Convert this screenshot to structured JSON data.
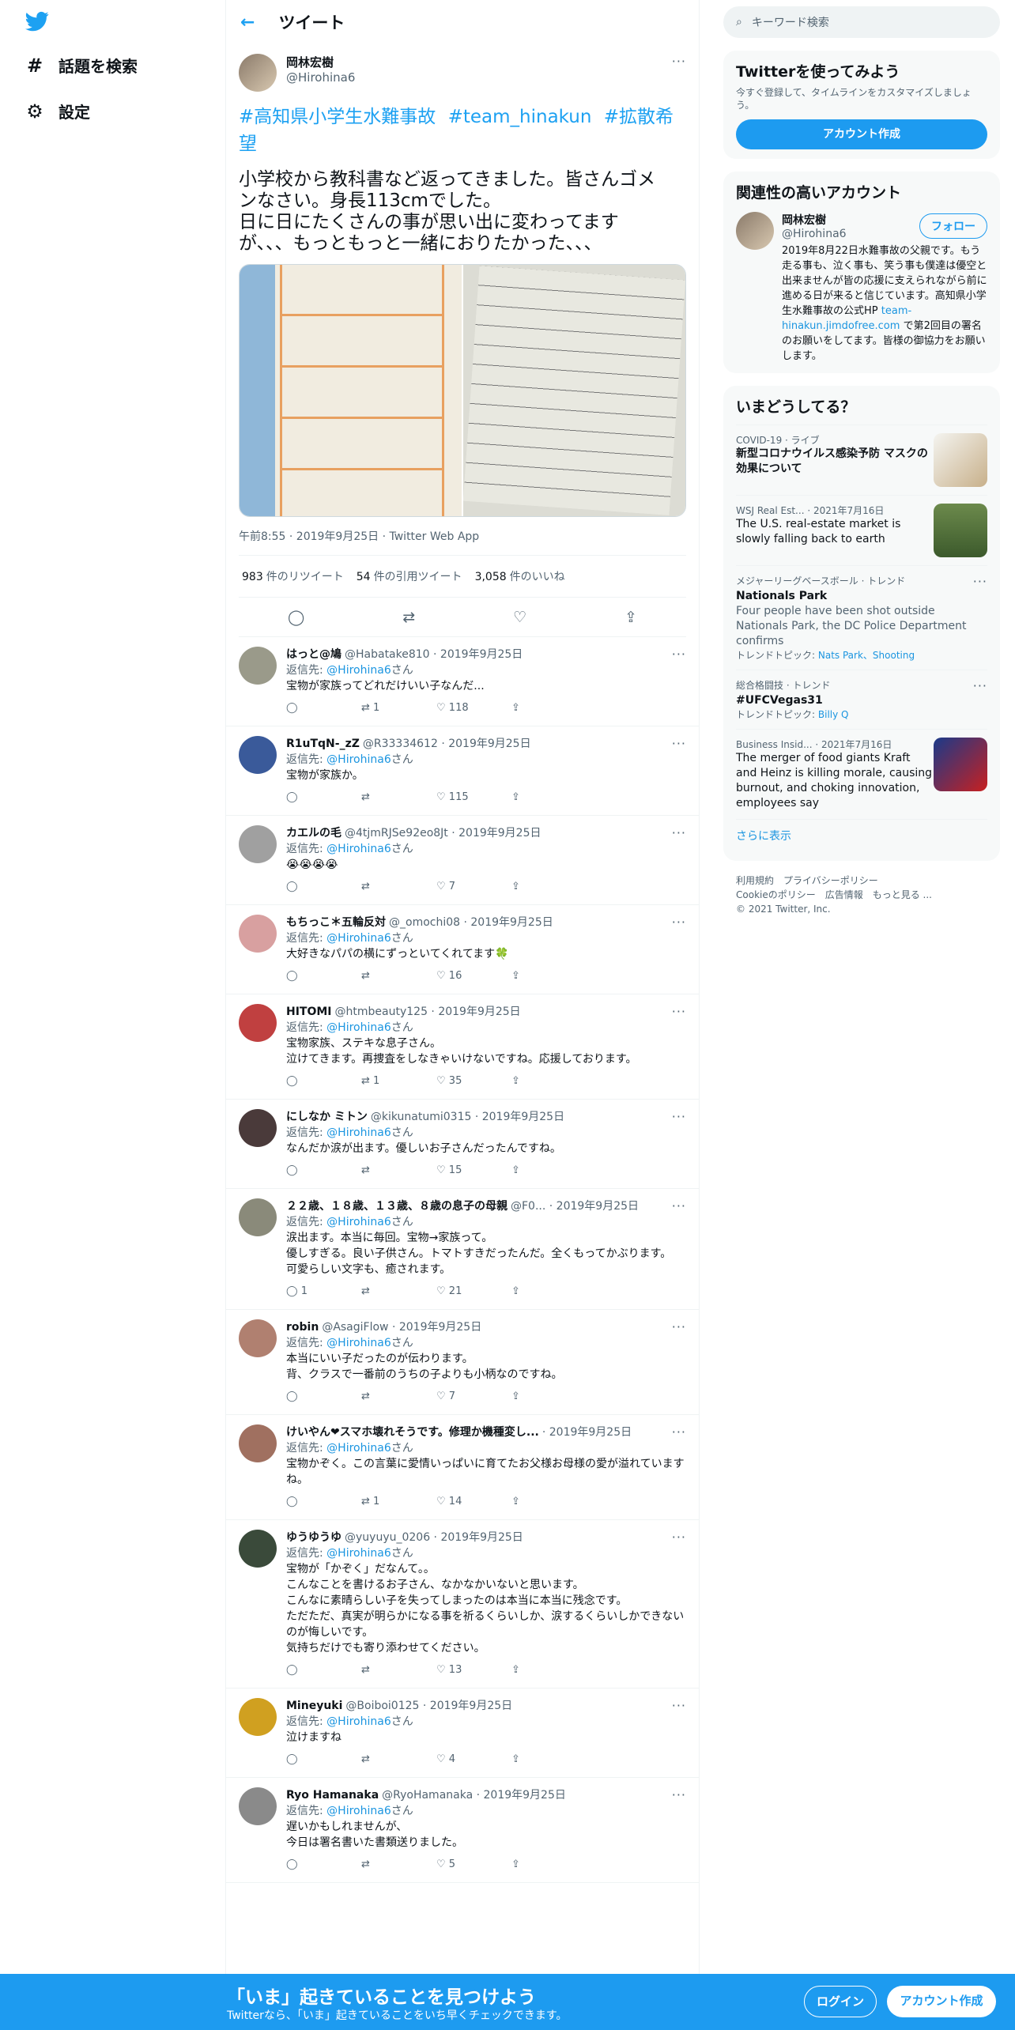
{
  "header": {
    "title": "ツイート"
  },
  "nav": {
    "explore": "話題を検索",
    "settings": "設定"
  },
  "tweet": {
    "name": "岡林宏樹",
    "handle": "@Hirohina6",
    "hashtags": "#高知県小学生水難事故 #team_hinakun #拡散希望",
    "body_line1": "小学校から教科書など返ってきました。皆さんゴメ",
    "body_line2": "ンなさい。身長113cmでした。",
    "body_line3": "日に日にたくさんの事が思い出に変わってます",
    "body_line4": "が、、、もっともっと一緒におりたかった、、、",
    "meta": "午前8:55 · 2019年9月25日 · Twitter Web App",
    "retweets_n": "983",
    "retweets_l": "件のリツイート",
    "quotes_n": "54",
    "quotes_l": "件の引用ツイート",
    "likes_n": "3,058",
    "likes_l": "件のいいね"
  },
  "reply_to_label": "返信先:",
  "reply_to_handle": "@Hirohina6",
  "reply_to_suffix": "さん",
  "replies": [
    {
      "name": "はっと@鳩",
      "handle": "@Habatake810 · 2019年9月25日",
      "text": "宝物が家族ってどれだけいい子なんだ...",
      "rt": "1",
      "like": "118"
    },
    {
      "name": "R1uTqN-_zZ",
      "handle": "@R33334612 · 2019年9月25日",
      "text": "宝物が家族か。",
      "rt": "",
      "like": "115"
    },
    {
      "name": "カエルの毛",
      "handle": "@4tjmRJSe92eo8Jt · 2019年9月25日",
      "text": "😭😭😭😭",
      "rt": "",
      "like": "7"
    },
    {
      "name": "もちっこ＊五輪反対",
      "handle": "@_omochi08 · 2019年9月25日",
      "text": "大好きなパパの横にずっといてくれてます🍀",
      "rt": "",
      "like": "16"
    },
    {
      "name": "HITOMI",
      "handle": "@htmbeauty125 · 2019年9月25日",
      "text": "宝物家族、ステキな息子さん。\n泣けてきます。再捜査をしなきゃいけないですね。応援しております。",
      "rt": "1",
      "like": "35"
    },
    {
      "name": "にしなか ミトン",
      "handle": "@kikunatumi0315 · 2019年9月25日",
      "text": "なんだか涙が出ます。優しいお子さんだったんですね。",
      "rt": "",
      "like": "15"
    },
    {
      "name": "２２歳、１８歳、１３歳、８歳の息子の母親",
      "handle": "@F0... · 2019年9月25日",
      "text": "涙出ます。本当に毎回。宝物→家族って。\n優しすぎる。良い子供さん。トマトすきだったんだ。全くもってかぶります。\n可愛らしい文字も、癒されます。",
      "rt": "",
      "like": "21",
      "reply": "1"
    },
    {
      "name": "robin",
      "handle": "@AsagiFlow · 2019年9月25日",
      "text": "本当にいい子だったのが伝わります。\n背、クラスで一番前のうちの子よりも小柄なのですね。",
      "rt": "",
      "like": "7"
    },
    {
      "name": "けいやん❤スマホ壊れそうです。修理か機種変し...",
      "handle": "· 2019年9月25日",
      "text": "宝物かぞく。この言葉に愛情いっぱいに育てたお父様お母様の愛が溢れていますね。",
      "rt": "1",
      "like": "14"
    },
    {
      "name": "ゆうゆうゆ",
      "handle": "@yuyuyu_0206 · 2019年9月25日",
      "text": "宝物が「かぞく」だなんて。。\nこんなことを書けるお子さん、なかなかいないと思います。\nこんなに素晴らしい子を失ってしまったのは本当に本当に残念です。\nただただ、真実が明らかになる事を祈るくらいしか、涙するくらいしかできないのが悔しいです。\n気持ちだけでも寄り添わせてください。",
      "rt": "",
      "like": "13"
    },
    {
      "name": "Mineyuki",
      "handle": "@Boiboi0125 · 2019年9月25日",
      "text": "泣けますね",
      "rt": "",
      "like": "4"
    },
    {
      "name": "Ryo Hamanaka",
      "handle": "@RyoHamanaka · 2019年9月25日",
      "text": "遅いかもしれませんが、\n今日は署名書いた書類送りました。",
      "rt": "",
      "like": "5"
    }
  ],
  "right": {
    "search_placeholder": "キーワード検索",
    "signup_title": "Twitterを使ってみよう",
    "signup_text": "今すぐ登録して、タイムラインをカスタマイズしましょう。",
    "signup_btn": "アカウント作成",
    "related_title": "関連性の高いアカウント",
    "related_name": "岡林宏樹",
    "related_handle": "@Hirohina6",
    "follow": "フォロー",
    "related_bio": "2019年8月22日水難事故の父親です。もう走る事も、泣く事も、笑う事も僕達は優空と出来ませんが皆の応援に支えられながら前に進める日が来ると信じています。高知県小学生水難事故の公式HP",
    "related_link": "team-hinakun.jimdofree.com",
    "related_bio2": "で第2回目の署名のお願いをしてます。皆様の御協力をお願いします。",
    "trends_title": "いまどうしてる？",
    "t1_cat": "COVID-19 · ライブ",
    "t1_title": "新型コロナウイルス感染予防 マスクの効果について",
    "t2_cat": "WSJ Real Est... · 2021年7月16日",
    "t2_title": "The U.S. real-estate market is slowly falling back to earth",
    "t3_cat": "メジャーリーグベースボール · トレンド",
    "t3_title": "Nationals Park",
    "t3_desc": "Four people have been shot outside Nationals Park, the DC Police Department confirms",
    "t3_topic_l": "トレンドトピック:",
    "t3_topic": "Nats Park、Shooting",
    "t4_cat": "総合格闘技 · トレンド",
    "t4_title": "#UFCVegas31",
    "t4_topic_l": "トレンドトピック:",
    "t4_topic": "Billy Q",
    "t5_cat": "Business Insid... · 2021年7月16日",
    "t5_title": "The merger of food giants Kraft and Heinz is killing morale, causing burnout, and choking innovation, employees say",
    "more": "さらに表示",
    "foot1": "利用規約　プライバシーポリシー",
    "foot2": "Cookieのポリシー　広告情報　もっと見る ...",
    "foot3": "© 2021 Twitter, Inc."
  },
  "bottom": {
    "title": "「いま」起きていることを見つけよう",
    "sub": "Twitterなら、「いま」起きていることをいち早くチェックできます。",
    "login": "ログイン",
    "signup": "アカウント作成"
  },
  "colors": {
    "accent": "#1d9bf0",
    "text": "#0f1419",
    "muted": "#536471"
  },
  "icons": [
    "twitter-logo-icon",
    "hash-icon",
    "gear-icon",
    "back-arrow-icon",
    "reply-icon",
    "retweet-icon",
    "like-icon",
    "share-icon",
    "search-icon",
    "more-icon",
    "verified-icon"
  ]
}
